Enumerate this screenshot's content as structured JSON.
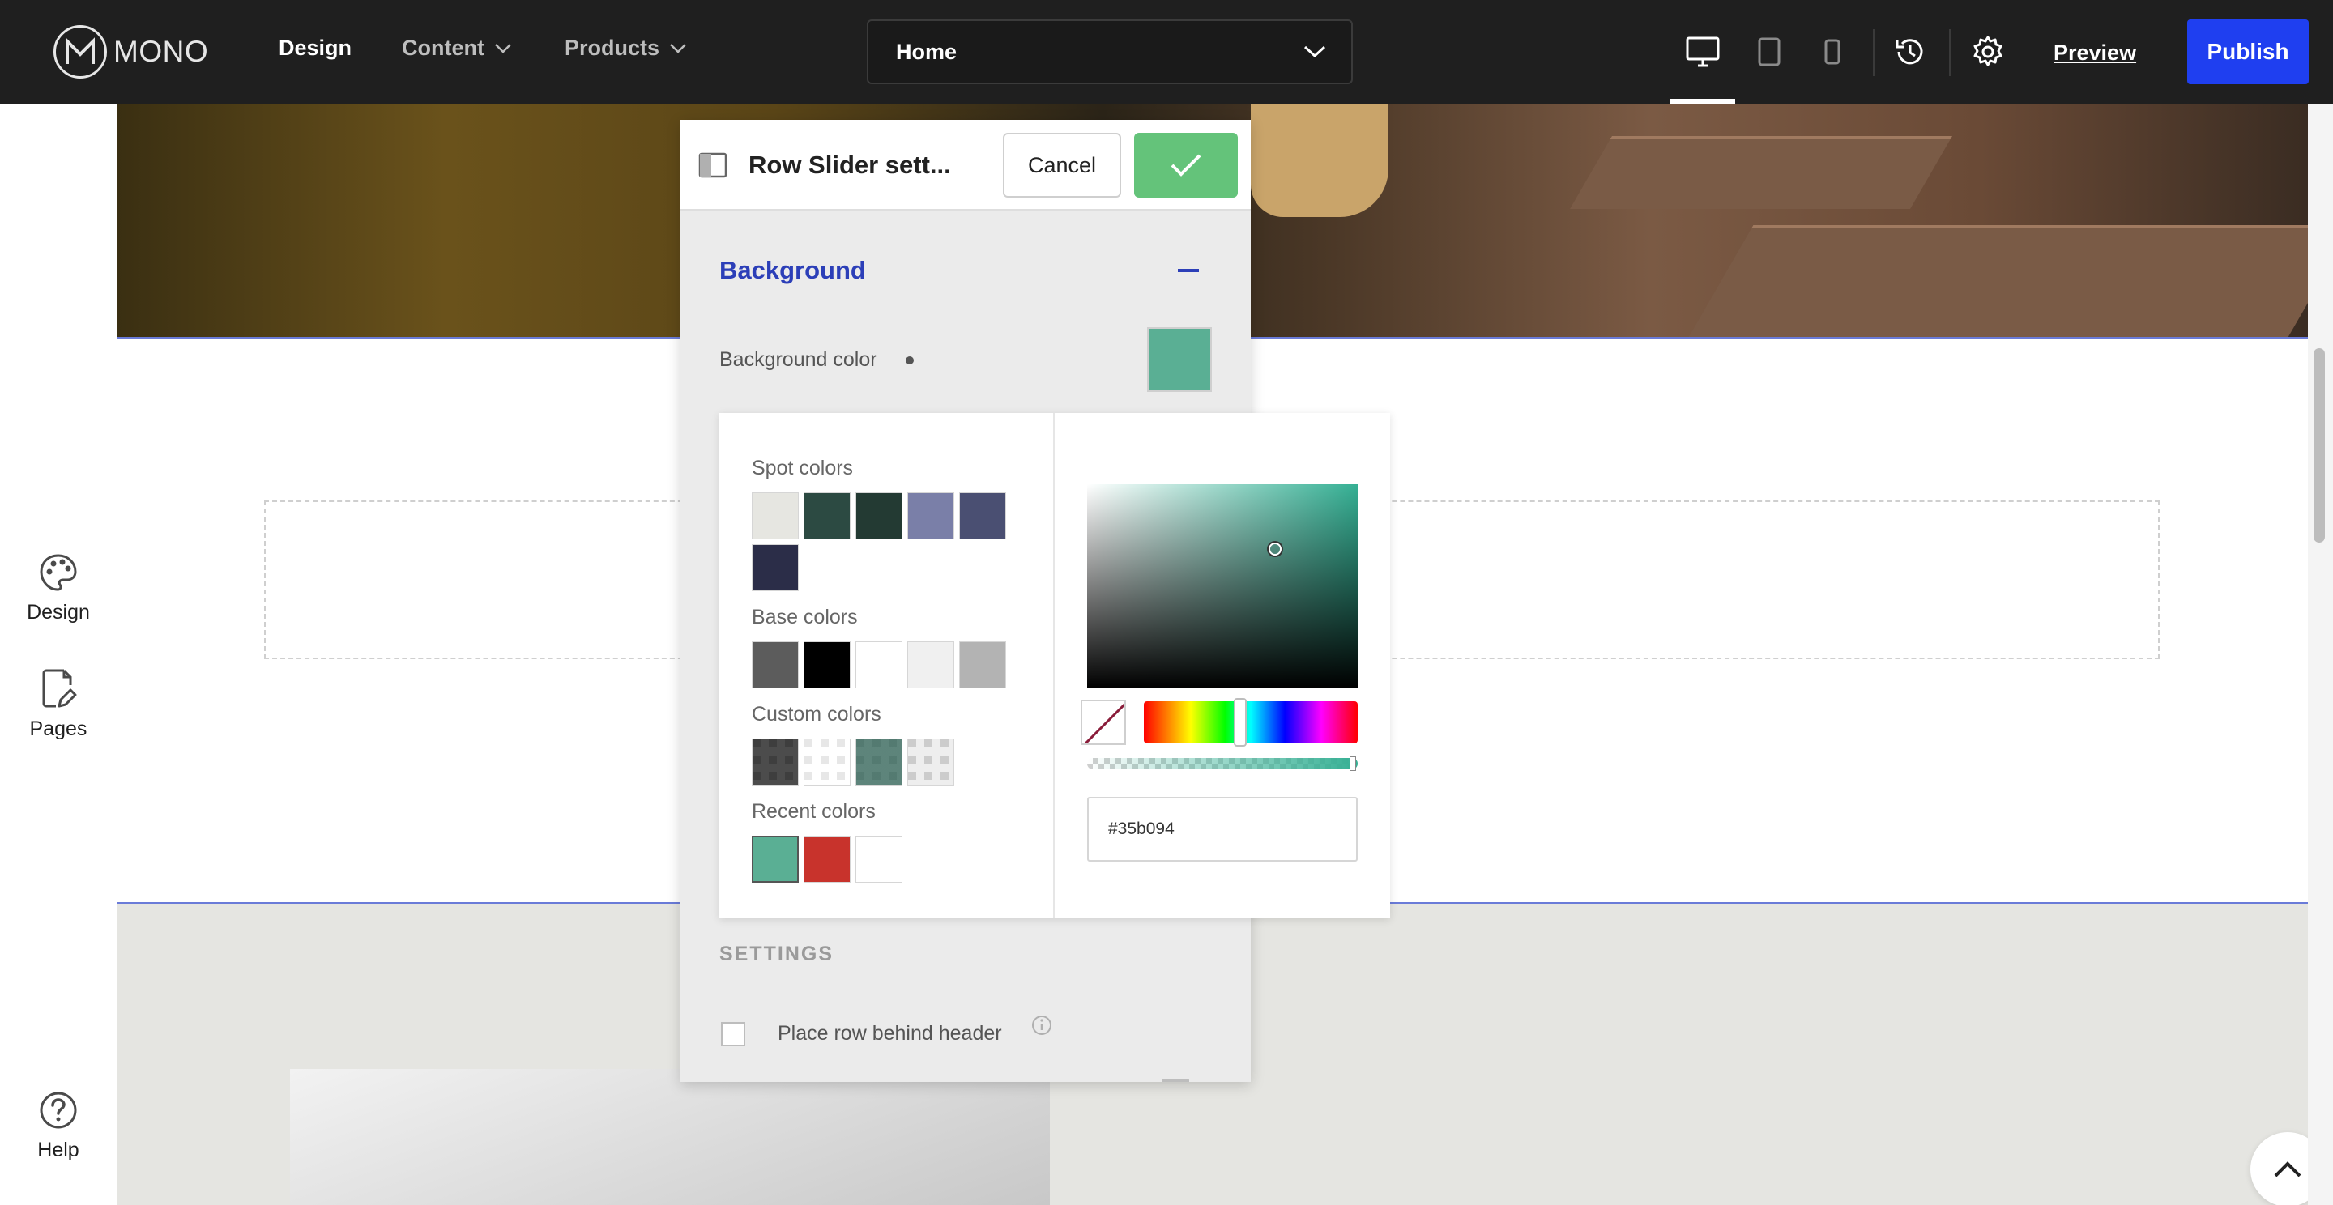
{
  "topbar": {
    "logo_text": "MONO",
    "nav": [
      {
        "label": "Design",
        "active": true
      },
      {
        "label": "Content",
        "has_dropdown": true
      },
      {
        "label": "Products",
        "has_dropdown": true
      }
    ],
    "page_select": {
      "value": "Home"
    },
    "device_icons": [
      "desktop-icon",
      "tablet-icon",
      "mobile-icon"
    ],
    "active_device": "desktop",
    "preview_label": "Preview",
    "publish_label": "Publish",
    "colors": {
      "bar": "#1f1f1f",
      "publish": "#1f3ff0"
    }
  },
  "left_sidebar": {
    "items": [
      {
        "label": "Design",
        "icon": "palette-icon"
      },
      {
        "label": "Pages",
        "icon": "page-edit-icon"
      },
      {
        "label": "Help",
        "icon": "help-circle-icon"
      }
    ]
  },
  "panel": {
    "title": "Row Slider sett...",
    "cancel_label": "Cancel",
    "section_heading": "Background",
    "background_color_label": "Background color",
    "background_color_value": "#5aaf94",
    "settings_heading": "SETTINGS",
    "place_behind_header_label": "Place row behind header",
    "place_behind_header_checked": false
  },
  "color_picker": {
    "spot_label": "Spot colors",
    "spot_colors": [
      "#e6e6e1",
      "#2c4a42",
      "#233a33",
      "#7a7fa8",
      "#4a4f72",
      "#2b2d48"
    ],
    "base_label": "Base colors",
    "base_colors": [
      "#5c5c5c",
      "#000000",
      "#ffffff",
      "#f0f0f0",
      "#b3b3b3"
    ],
    "custom_label": "Custom colors",
    "custom_colors": [
      "rgba(0,0,0,0.7)",
      "rgba(255,255,255,0.5)",
      "rgba(53,102,90,0.8)",
      "rgba(200,200,200,0.3)"
    ],
    "recent_label": "Recent colors",
    "recent_colors": [
      "#5aaf94",
      "#c8332c",
      "#ffffff"
    ],
    "hex_value": "#35b094",
    "hue_fraction": 0.45,
    "alpha_fraction": 1.0
  }
}
